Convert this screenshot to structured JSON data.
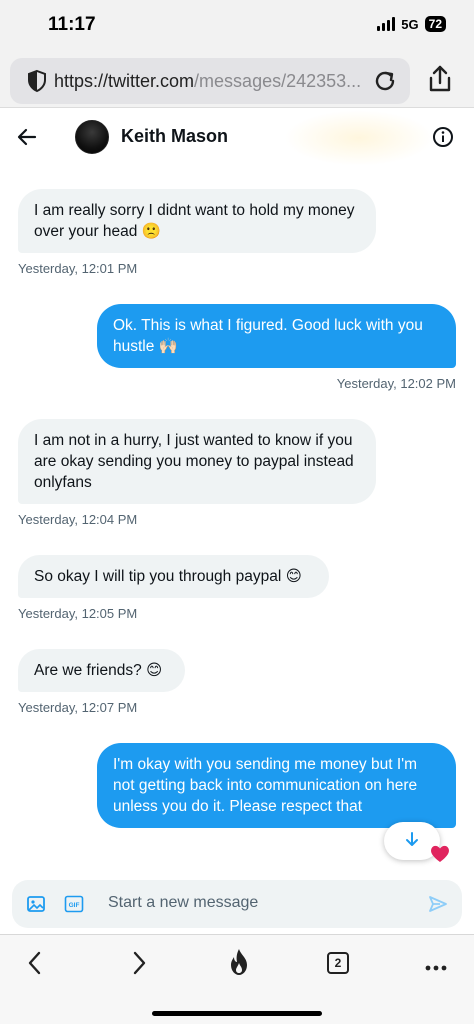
{
  "status": {
    "time": "11:17",
    "network": "5G",
    "battery": "72"
  },
  "browser": {
    "url_host": "https://twitter.com",
    "url_path": "/messages/242353..."
  },
  "chat": {
    "contact_name": "Keith Mason"
  },
  "messages": [
    {
      "direction": "in",
      "text": "I am really sorry I didnt want to hold my money over your head 🙁",
      "time": "Yesterday, 12:01 PM"
    },
    {
      "direction": "out",
      "text": "Ok.  This is what I figured.  Good luck with you hustle 🙌🏻",
      "time": "Yesterday, 12:02 PM"
    },
    {
      "direction": "in",
      "text": "I am not in a hurry, I just wanted to know if you are okay sending you money to paypal instead onlyfans",
      "time": "Yesterday, 12:04 PM"
    },
    {
      "direction": "in",
      "text": "So okay I will tip you through paypal 😊",
      "time": "Yesterday, 12:05 PM"
    },
    {
      "direction": "in",
      "text": "Are we friends? 😊",
      "time": "Yesterday, 12:07 PM"
    },
    {
      "direction": "out",
      "text": "I'm okay with you sending me money but I'm not getting back into communication on here unless you do it.  Please respect that",
      "time": ""
    }
  ],
  "composer": {
    "placeholder": "Start a new message",
    "gif_label": "GIF"
  },
  "bottom_nav": {
    "tabs_count": "2"
  },
  "colors": {
    "accent": "#1d9bf0",
    "incoming_bubble": "#eff3f4",
    "heart": "#e0245e"
  },
  "icons": [
    "shield-icon",
    "reload-icon",
    "share-icon",
    "back-arrow-icon",
    "info-icon",
    "image-icon",
    "gif-icon",
    "send-icon",
    "chevron-left-icon",
    "chevron-right-icon",
    "flame-icon",
    "tabs-icon",
    "more-icon",
    "arrow-down-icon",
    "heart-icon"
  ]
}
